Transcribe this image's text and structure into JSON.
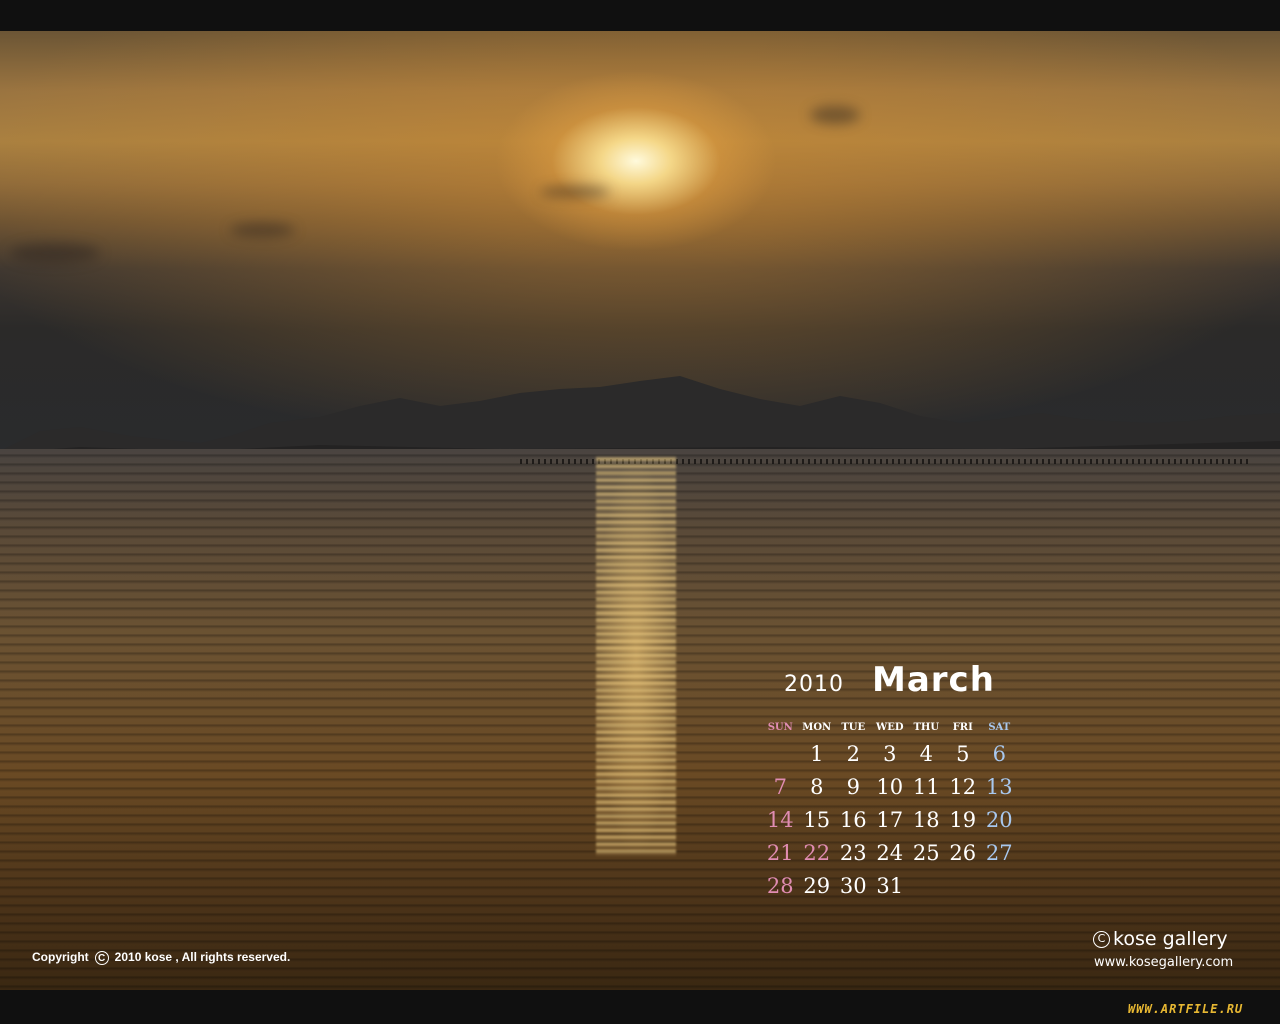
{
  "calendar": {
    "year": "2010",
    "month": "March",
    "weekdays": [
      "SUN",
      "MON",
      "TUE",
      "WED",
      "THU",
      "FRI",
      "SAT"
    ],
    "weeks": [
      [
        "",
        "1",
        "2",
        "3",
        "4",
        "5",
        "6"
      ],
      [
        "7",
        "8",
        "9",
        "10",
        "11",
        "12",
        "13"
      ],
      [
        "14",
        "15",
        "16",
        "17",
        "18",
        "19",
        "20"
      ],
      [
        "21",
        "22",
        "23",
        "24",
        "25",
        "26",
        "27"
      ],
      [
        "28",
        "29",
        "30",
        "31",
        "",
        "",
        ""
      ]
    ],
    "holidays": [
      "22"
    ]
  },
  "footer": {
    "copyright_prefix": "Copyright",
    "copyright_symbol": "C",
    "copyright_text": "2010  kose , All rights reserved.",
    "brand_symbol": "C",
    "brand_name": "kose gallery",
    "website": "www.kosegallery.com",
    "watermark": "WWW.ARTFILE.RU"
  },
  "colors": {
    "sunday": "#e08cb2",
    "saturday": "#a8c8ef",
    "weekday": "#ffffff"
  }
}
